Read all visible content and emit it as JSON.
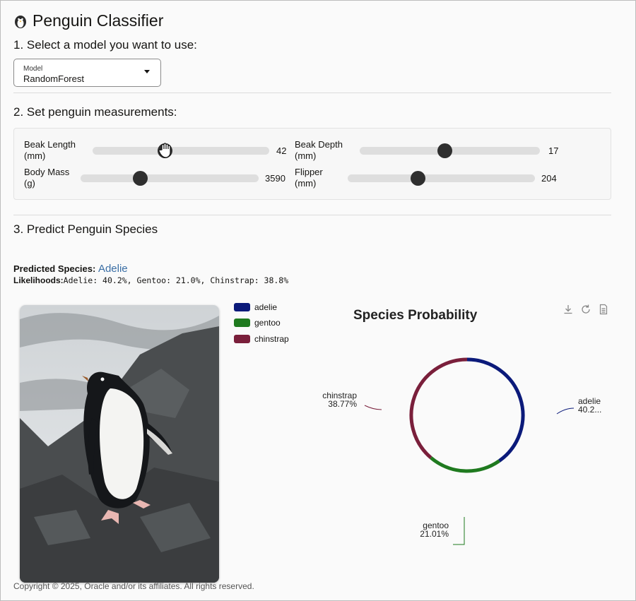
{
  "app": {
    "title": "Penguin Classifier"
  },
  "steps": {
    "select_model": "1. Select a model you want to use:",
    "measurements": "2. Set penguin measurements:",
    "predict": "3. Predict Penguin Species"
  },
  "model_select": {
    "label": "Model",
    "value": "RandomForest"
  },
  "sliders": [
    {
      "label_line1": "Beak Length",
      "label_line2": "(mm)",
      "value": "42",
      "level": 0.38
    },
    {
      "label_line1": "Beak Depth",
      "label_line2": "(mm)",
      "value": "17",
      "level": 0.5
    },
    {
      "label_line1": "Body Mass",
      "label_line2": "(g)",
      "value": "3590",
      "level": 0.34
    },
    {
      "label_line1": "Flipper",
      "label_line2": "(mm)",
      "value": "204",
      "level": 0.37
    }
  ],
  "prediction": {
    "label": "Predicted Species:",
    "species": "Adelie",
    "likelihoods_label": "Likelihoods:",
    "likelihoods_text": "Adelie: 40.2%, Gentoo: 21.0%, Chinstrap: 38.8%"
  },
  "legend": [
    {
      "name": "adelie",
      "color": "#0b1a7a"
    },
    {
      "name": "gentoo",
      "color": "#1f7a1f"
    },
    {
      "name": "chinstrap",
      "color": "#7a1f3b"
    }
  ],
  "chart_data": {
    "type": "pie",
    "title": "Species Probability",
    "categories": [
      "adelie",
      "gentoo",
      "chinstrap"
    ],
    "values": [
      40.22,
      21.01,
      38.77
    ],
    "value_labels": [
      "40.2...",
      "21.01%",
      "38.77%"
    ],
    "colors": [
      "#0b1a7a",
      "#1f7a1f",
      "#7a1f3b"
    ],
    "legend": "top-left"
  },
  "toolbar_icons": [
    "download-icon",
    "refresh-icon",
    "document-icon"
  ],
  "footer": "Copyright © 2025, Oracle and/or its affiliates. All rights reserved."
}
